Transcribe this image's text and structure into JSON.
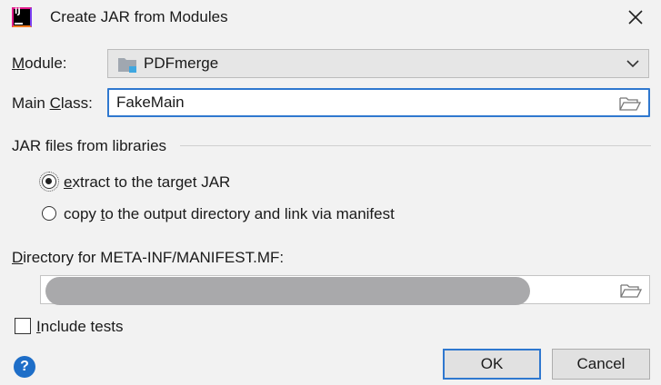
{
  "window": {
    "title": "Create JAR from Modules",
    "icon": "intellij-idea-icon",
    "app_icon_text": "IJ"
  },
  "module": {
    "label_prefix": "",
    "label_mnemonic": "M",
    "label_rest": "odule:",
    "value": "PDFmerge"
  },
  "main_class": {
    "label_prefix": "Main ",
    "label_mnemonic": "C",
    "label_rest": "lass:",
    "value": "FakeMain"
  },
  "libraries": {
    "group_label": "JAR files from libraries",
    "options": [
      {
        "mnemonic": "e",
        "rest": "xtract to the target JAR",
        "prefix": "",
        "checked": true
      },
      {
        "prefix": "copy ",
        "mnemonic": "t",
        "rest": "o the output directory and link via manifest",
        "checked": false
      }
    ]
  },
  "manifest_dir": {
    "label_mnemonic": "D",
    "label_rest": "irectory for META-INF/MANIFEST.MF:",
    "value": ""
  },
  "include_tests": {
    "mnemonic": "I",
    "rest": "nclude tests",
    "checked": false
  },
  "buttons": {
    "help": "?",
    "ok": "OK",
    "cancel": "Cancel"
  },
  "colors": {
    "accent": "#2f78cf",
    "dialog_bg": "#f2f2f2",
    "help_blue": "#1e6ec8",
    "redaction": "#a9a9ab"
  }
}
